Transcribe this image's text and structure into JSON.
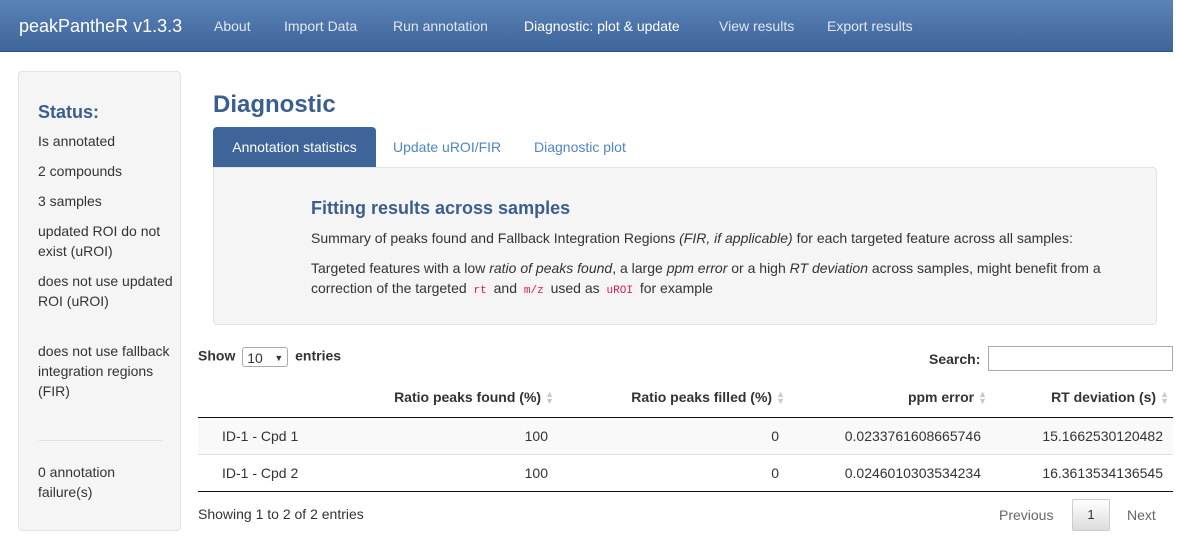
{
  "navbar": {
    "brand": "peakPantheR v1.3.3",
    "items": [
      {
        "label": "About"
      },
      {
        "label": "Import Data"
      },
      {
        "label": "Run annotation"
      },
      {
        "label": "Diagnostic: plot & update"
      },
      {
        "label": "View results"
      },
      {
        "label": "Export results"
      }
    ],
    "active_index": 3
  },
  "sidebar": {
    "title": "Status:",
    "lines": [
      "Is annotated",
      "2 compounds",
      "3 samples",
      "updated ROI do not exist (uROI)",
      "does not use updated ROI (uROI)",
      "does not use fallback integration regions (FIR)"
    ],
    "failures": "0 annotation failure(s)"
  },
  "main": {
    "title": "Diagnostic",
    "tabs": [
      {
        "label": "Annotation statistics"
      },
      {
        "label": "Update uROI/FIR"
      },
      {
        "label": "Diagnostic plot"
      }
    ],
    "active_tab": 0
  },
  "panel": {
    "title": "Fitting results across samples",
    "p1_a": "Summary of peaks found and Fallback Integration Regions ",
    "p1_em": "(FIR, if applicable)",
    "p1_b": " for each targeted feature across all samples:",
    "p2_a": "Targeted features with a low ",
    "p2_em1": "ratio of peaks found",
    "p2_b": ", a large ",
    "p2_em2": "ppm error",
    "p2_c": " or a high ",
    "p2_em3": "RT deviation",
    "p2_d": " across samples, might benefit from a correction of the targeted ",
    "code_rt": "rt",
    "p2_e": " and ",
    "code_mz": "m/z",
    "p2_f": " used as ",
    "code_uroi": "uROI",
    "p2_g": " for example"
  },
  "table_controls": {
    "show": "Show",
    "length_value": "10",
    "entries": "entries",
    "search_label": "Search:",
    "search_value": ""
  },
  "table": {
    "columns": [
      "",
      "Ratio peaks found (%)",
      "Ratio peaks filled (%)",
      "ppm error",
      "RT deviation (s)"
    ],
    "rows": [
      [
        "ID-1 - Cpd 1",
        "100",
        "0",
        "0.0233761608665746",
        "15.1662530120482"
      ],
      [
        "ID-1 - Cpd 2",
        "100",
        "0",
        "0.0246010303534234",
        "16.3613534136545"
      ]
    ]
  },
  "footer": {
    "info": "Showing 1 to 2 of 2 entries",
    "previous": "Previous",
    "page": "1",
    "next": "Next"
  }
}
